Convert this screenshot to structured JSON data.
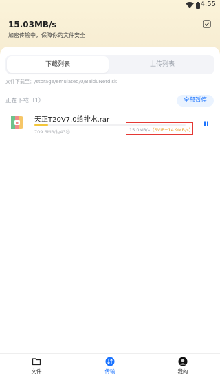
{
  "status_bar": {
    "time": "4:55"
  },
  "header": {
    "speed": "15.03MB/s",
    "subtitle": "加密传输中，保障你的文件安全"
  },
  "tabs": [
    {
      "label": "下载列表",
      "active": true
    },
    {
      "label": "上传列表",
      "active": false
    }
  ],
  "path_label": "文件下载至：/storage/emulated/0/BaiduNetdisk",
  "section": {
    "title": "正在下载（1）",
    "pause_all_label": "全部暂停"
  },
  "downloads": [
    {
      "name": "天正T20V7.0给排水.rar",
      "size_info": "709.6MB/约43秒",
      "speed": "15.0MB/s",
      "vip_speed": "（SVIP+14.9MB/s）",
      "progress": 0.09
    }
  ],
  "nav": [
    {
      "label": "文件",
      "icon": "folder-icon",
      "active": false
    },
    {
      "label": "传输",
      "icon": "transfer-icon",
      "active": true
    },
    {
      "label": "我的",
      "icon": "avatar-icon",
      "active": false
    }
  ],
  "colors": {
    "accent": "#1a73ff",
    "vip": "#e8a22a",
    "highlight_box": "#e53935",
    "header_bg": "#fbf3d9"
  }
}
